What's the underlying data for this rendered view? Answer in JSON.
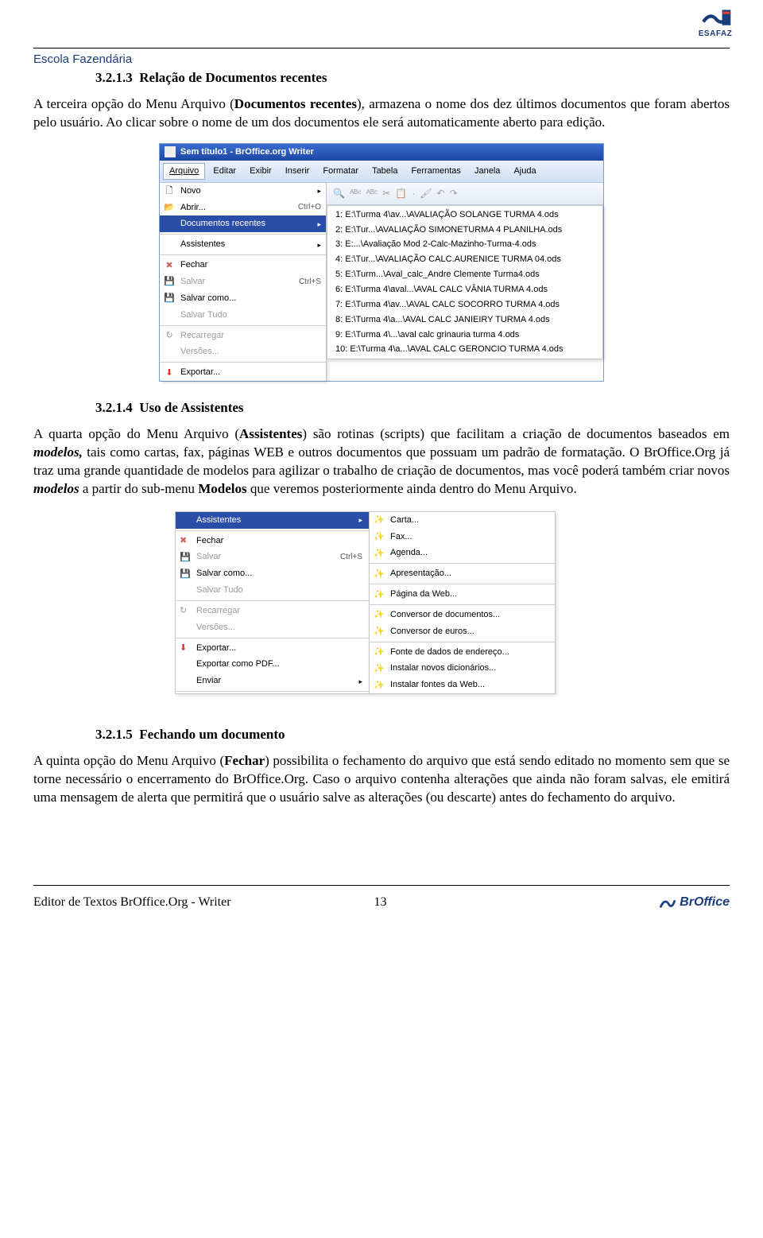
{
  "header": {
    "school": "Escola Fazendária",
    "logo_caption": "ESAFAZ"
  },
  "s1": {
    "num": "3.2.1.3",
    "title": "Relação de Documentos recentes",
    "p1a": "A terceira opção do Menu Arquivo (",
    "p1b": "Documentos recentes",
    "p1c": "), armazena o nome dos dez últimos documentos que foram abertos pelo usuário. Ao clicar sobre o nome de um dos documentos ele será automaticamente aberto para edição."
  },
  "fig1": {
    "window_title": "Sem título1 - BrOffice.org Writer",
    "menubar": [
      "Arquivo",
      "Editar",
      "Exibir",
      "Inserir",
      "Formatar",
      "Tabela",
      "Ferramentas",
      "Janela",
      "Ajuda"
    ],
    "menu": {
      "novo": "Novo",
      "abrir": "Abrir...",
      "abrir_kb": "Ctrl+O",
      "doc_rec": "Documentos recentes",
      "assist": "Assistentes",
      "fechar": "Fechar",
      "salvar": "Salvar",
      "salvar_kb": "Ctrl+S",
      "salvar_como": "Salvar como...",
      "salvar_tudo": "Salvar Tudo",
      "recarregar": "Recarregar",
      "versoes": "Versões...",
      "exportar": "Exportar..."
    },
    "recents": [
      "1: E:\\Turma 4\\av...\\AVALIAÇÃO SOLANGE TURMA 4.ods",
      "2: E:\\Tur...\\AVALIAÇÃO SIMONETURMA 4 PLANILHA.ods",
      "3: E:...\\Avaliação Mod 2-Calc-Mazinho-Turma-4.ods",
      "4: E:\\Tur...\\AVALIAÇÃO CALC.AURENICE TURMA 04.ods",
      "5: E:\\Turm...\\Aval_calc_Andre Clemente Turma4.ods",
      "6: E:\\Turma 4\\aval...\\AVAL CALC VÂNIA TURMA 4.ods",
      "7: E:\\Turma 4\\av...\\AVAL CALC SOCORRO TURMA 4.ods",
      "8: E:\\Turma 4\\a...\\AVAL CALC JANIEIRY TURMA 4.ods",
      "9: E:\\Turma 4\\...\\aval calc grinauria turma 4.ods",
      "10: E:\\Turma 4\\a...\\AVAL CALC GERONCIO TURMA 4.ods"
    ]
  },
  "s2": {
    "num": "3.2.1.4",
    "title": "Uso de Assistentes",
    "p_a": "A quarta opção do Menu Arquivo (",
    "p_b": "Assistentes",
    "p_c": ") são rotinas (scripts) que facilitam a criação de documentos baseados em ",
    "p_d": "modelos,",
    "p_e": " tais como cartas, fax, páginas WEB e outros documentos que possuam um padrão de formatação. O BrOffice.Org já traz uma grande quantidade de modelos para agilizar o trabalho de criação de documentos, mas você poderá também criar novos ",
    "p_f": "modelos",
    "p_g": " a partir do sub-menu ",
    "p_h": "Modelos",
    "p_i": " que veremos posteriormente ainda dentro do Menu Arquivo."
  },
  "fig2": {
    "left": {
      "assist": "Assistentes",
      "fechar": "Fechar",
      "salvar": "Salvar",
      "salvar_kb": "Ctrl+S",
      "salvar_como": "Salvar como...",
      "salvar_tudo": "Salvar Tudo",
      "recarregar": "Recarregar",
      "versoes": "Versões...",
      "exportar": "Exportar...",
      "exportar_pdf": "Exportar como PDF...",
      "enviar": "Enviar"
    },
    "right": [
      "Carta...",
      "Fax...",
      "Agenda...",
      "—",
      "Apresentação...",
      "—",
      "Página da Web...",
      "—",
      "Conversor de documentos...",
      "Conversor de euros...",
      "—",
      "Fonte de dados de endereço...",
      "Instalar novos dicionários...",
      "Instalar fontes da Web..."
    ]
  },
  "s3": {
    "num": "3.2.1.5",
    "title": "Fechando um documento",
    "p_a": "A quinta opção do Menu Arquivo (",
    "p_b": "Fechar",
    "p_c": ") possibilita o fechamento do arquivo que está sendo editado no momento sem que se torne necessário o encerramento do BrOffice.Org. Caso o arquivo contenha alterações que ainda não foram salvas, ele emitirá uma mensagem de alerta que permitirá que o usuário salve as alterações (ou descarte) antes do fechamento do arquivo."
  },
  "footer": {
    "text": "Editor de Textos BrOffice.Org  -  Writer",
    "page": "13",
    "logo": "BrOffice"
  }
}
